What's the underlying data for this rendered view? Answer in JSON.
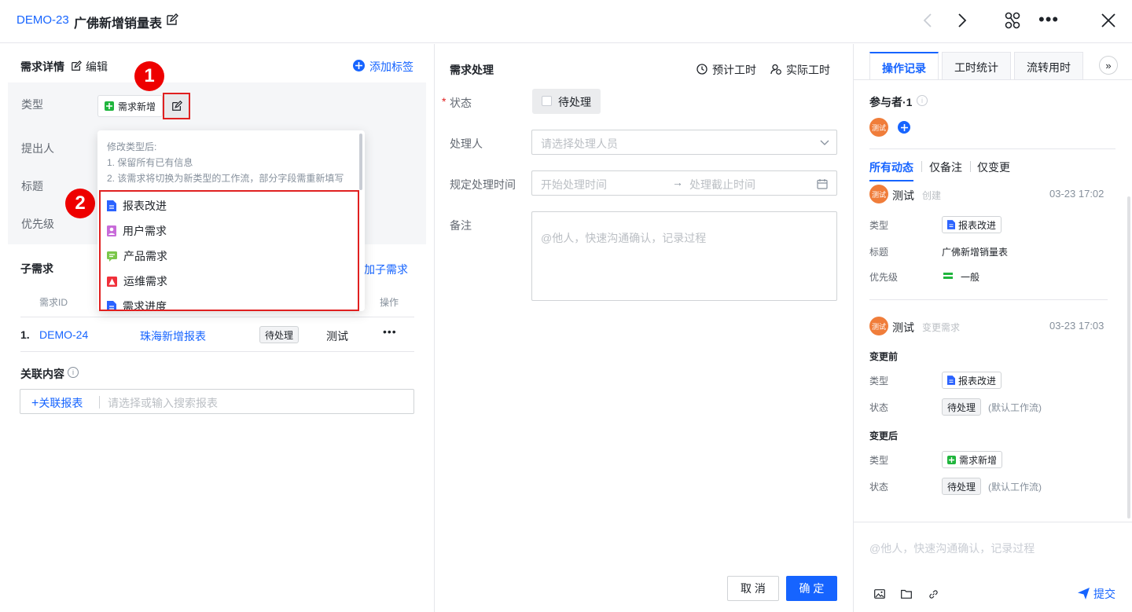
{
  "header": {
    "issue_id": "DEMO-23",
    "title": "广佛新增销量表"
  },
  "left": {
    "section_title": "需求详情",
    "edit_label": "编辑",
    "add_tag_label": "添加标签",
    "fields": {
      "type_label": "类型",
      "type_value": "需求新增",
      "reporter_label": "提出人",
      "title_label": "标题",
      "priority_label": "优先级"
    },
    "dropdown": {
      "hint_title": "修改类型后:",
      "hint_1": "1. 保留所有已有信息",
      "hint_2": "2. 该需求将切换为新类型的工作流，部分字段需重新填写",
      "options": [
        {
          "label": "报表改进",
          "color": "#2b63ff"
        },
        {
          "label": "用户需求",
          "color": "#c86bd9"
        },
        {
          "label": "产品需求",
          "color": "#7bc74a"
        },
        {
          "label": "运维需求",
          "color": "#f0303a"
        },
        {
          "label": "需求进度",
          "color": "#2b63ff"
        }
      ]
    },
    "markers": [
      "1",
      "2"
    ],
    "sub": {
      "title": "子需求",
      "add_label": "加子需求",
      "col_id": "需求ID",
      "col_action": "操作",
      "row": {
        "index": "1.",
        "id": "DEMO-24",
        "title": "珠海新增报表",
        "status": "待处理",
        "owner": "测试"
      }
    },
    "related": {
      "title": "关联内容",
      "link_label": "关联报表",
      "placeholder": "请选择或输入搜索报表"
    }
  },
  "middle": {
    "title": "需求处理",
    "estimate_label": "预计工时",
    "actual_label": "实际工时",
    "status_label": "状态",
    "status_value": "待处理",
    "handler_label": "处理人",
    "handler_placeholder": "请选择处理人员",
    "time_label": "规定处理时间",
    "time_start": "开始处理时间",
    "time_end": "处理截止时间",
    "note_label": "备注",
    "note_placeholder": "@他人，快速沟通确认，记录过程",
    "cancel_label": "取 消",
    "ok_label": "确 定"
  },
  "right": {
    "tabs": [
      "操作记录",
      "工时统计",
      "流转用时"
    ],
    "participants_label": "参与者·1",
    "avatar_text": "测试",
    "filters": [
      "所有动态",
      "仅备注",
      "仅变更"
    ],
    "log1": {
      "user": "测试",
      "action": "创建",
      "time": "03-23 17:02",
      "type_label": "类型",
      "type_value": "报表改进",
      "title_label": "标题",
      "title_value": "广佛新增销量表",
      "priority_label": "优先级",
      "priority_value": "一般"
    },
    "log2": {
      "user": "测试",
      "action": "变更需求",
      "time": "03-23 17:03",
      "before": "变更前",
      "after": "变更后",
      "type_label": "类型",
      "status_label": "状态",
      "before_type": "报表改进",
      "after_type": "需求新增",
      "status_value": "待处理",
      "workflow": "(默认工作流)"
    },
    "comment_placeholder": "@他人，快速沟通确认，记录过程",
    "submit_label": "提交"
  }
}
